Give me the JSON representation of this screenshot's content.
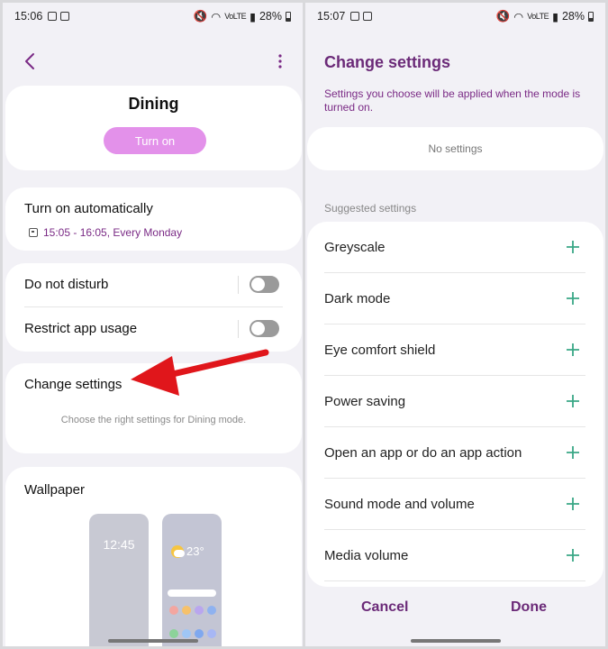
{
  "left": {
    "status": {
      "time": "15:06",
      "battery": "28%",
      "net_label": "VoLTE"
    },
    "mode_title": "Dining",
    "turn_on_button": "Turn on",
    "auto": {
      "title": "Turn on automatically",
      "schedule": "15:05 - 16:05, Every Monday"
    },
    "toggles": [
      {
        "label": "Do not disturb",
        "on": false
      },
      {
        "label": "Restrict app usage",
        "on": false
      }
    ],
    "change_settings": {
      "title": "Change settings",
      "subtitle": "Choose the right settings for Dining mode."
    },
    "wallpaper": {
      "title": "Wallpaper",
      "lock_clock": "12:45",
      "home_temp": "23°"
    }
  },
  "right": {
    "status": {
      "time": "15:07",
      "battery": "28%",
      "net_label": "VoLTE"
    },
    "title": "Change settings",
    "description": "Settings you choose will be applied when the mode is turned on.",
    "no_settings": "No settings",
    "suggested_label": "Suggested settings",
    "suggested": [
      "Greyscale",
      "Dark mode",
      "Eye comfort shield",
      "Power saving",
      "Open an app or do an app action",
      "Sound mode and volume",
      "Media volume"
    ],
    "cancel": "Cancel",
    "done": "Done"
  },
  "colors": {
    "accent": "#6b2a78",
    "turn_on_bg": "#e391ea",
    "plus": "#3aa886",
    "arrow": "#e0161b"
  }
}
